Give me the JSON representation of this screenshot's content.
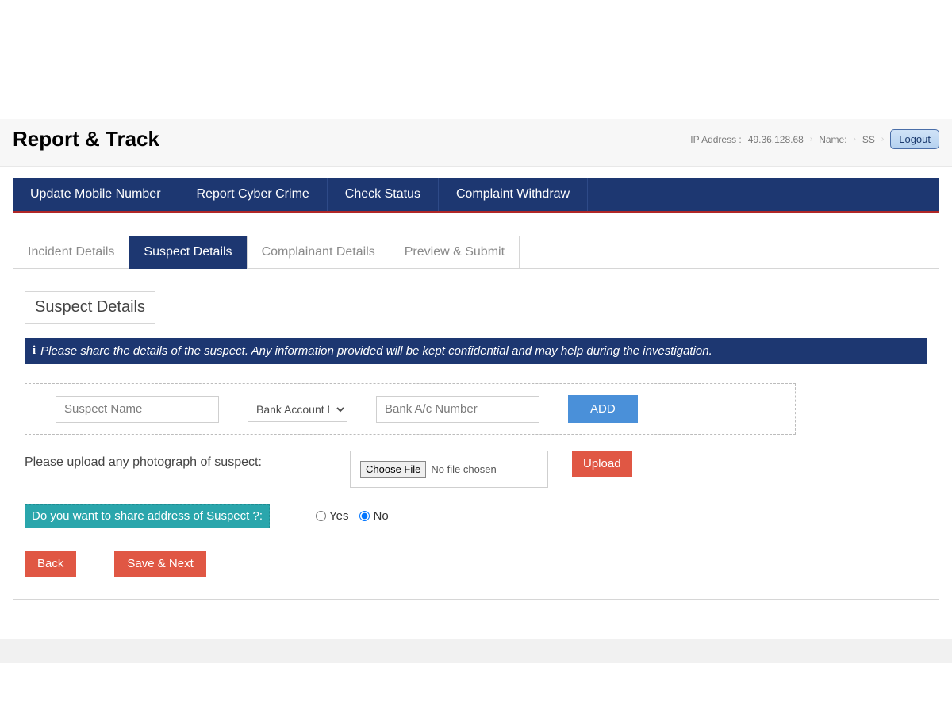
{
  "header": {
    "title": "Report & Track",
    "ip_label": "IP Address :",
    "ip_value": "49.36.128.68",
    "name_label": "Name:",
    "name_value": "SS",
    "logout": "Logout"
  },
  "nav": {
    "items": [
      "Update Mobile Number",
      "Report Cyber Crime",
      "Check Status",
      "Complaint Withdraw"
    ]
  },
  "tabs": {
    "items": [
      "Incident Details",
      "Suspect Details",
      "Complainant Details",
      "Preview & Submit"
    ],
    "active_index": 1
  },
  "section": {
    "heading": "Suspect Details",
    "info": "Please share the details of the suspect. Any information provided will be kept confidential and may help during the investigation."
  },
  "inputs": {
    "suspect_name_placeholder": "Suspect Name",
    "account_type_option": "Bank Account Number",
    "account_number_placeholder": "Bank A/c Number",
    "add_button": "ADD"
  },
  "upload": {
    "label": "Please upload any photograph of suspect:",
    "choose_file": "Choose File",
    "no_file": "No file chosen",
    "upload_button": "Upload"
  },
  "address_share": {
    "question": "Do you want to share address of Suspect ?:",
    "yes": "Yes",
    "no": "No",
    "selected": "no"
  },
  "buttons": {
    "back": "Back",
    "save_next": "Save & Next"
  }
}
